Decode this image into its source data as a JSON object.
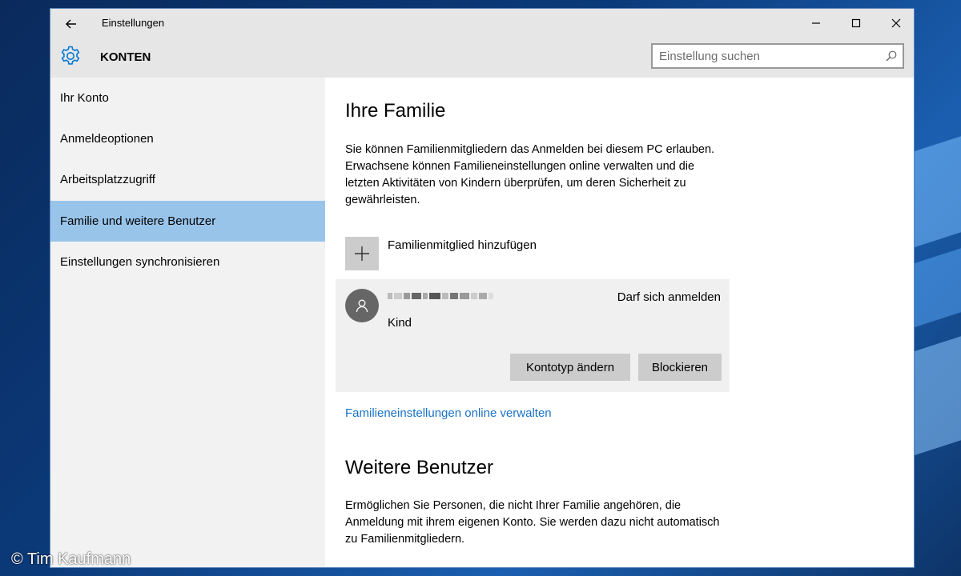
{
  "window": {
    "title": "Einstellungen",
    "section": "KONTEN",
    "search_placeholder": "Einstellung suchen"
  },
  "sidebar": {
    "items": [
      {
        "label": "Ihr Konto"
      },
      {
        "label": "Anmeldeoptionen"
      },
      {
        "label": "Arbeitsplatzzugriff"
      },
      {
        "label": "Familie und weitere Benutzer",
        "active": true
      },
      {
        "label": "Einstellungen synchronisieren"
      }
    ]
  },
  "family": {
    "heading": "Ihre Familie",
    "description": "Sie können Familienmitgliedern das Anmelden bei diesem PC erlauben. Erwachsene können Familieneinstellungen online verwalten und die letzten Aktivitäten von Kindern überprüfen, um deren Sicherheit zu gewährleisten.",
    "add_label": "Familienmitglied hinzufügen",
    "member": {
      "status": "Darf sich anmelden",
      "role": "Kind",
      "change_type_label": "Kontotyp ändern",
      "block_label": "Blockieren"
    },
    "manage_link": "Familieneinstellungen online verwalten"
  },
  "others": {
    "heading": "Weitere Benutzer",
    "description": "Ermöglichen Sie Personen, die nicht Ihrer Familie angehören, die Anmeldung mit ihrem eigenen Konto. Sie werden dazu nicht automatisch zu Familienmitgliedern."
  },
  "watermark": "© Tim Kaufmann",
  "colors": {
    "accent": "#0078d7",
    "selection": "#99c4ea",
    "link": "#1a73c8",
    "titlebar": "#e6e6e6",
    "sidebar": "#f2f2f2"
  }
}
